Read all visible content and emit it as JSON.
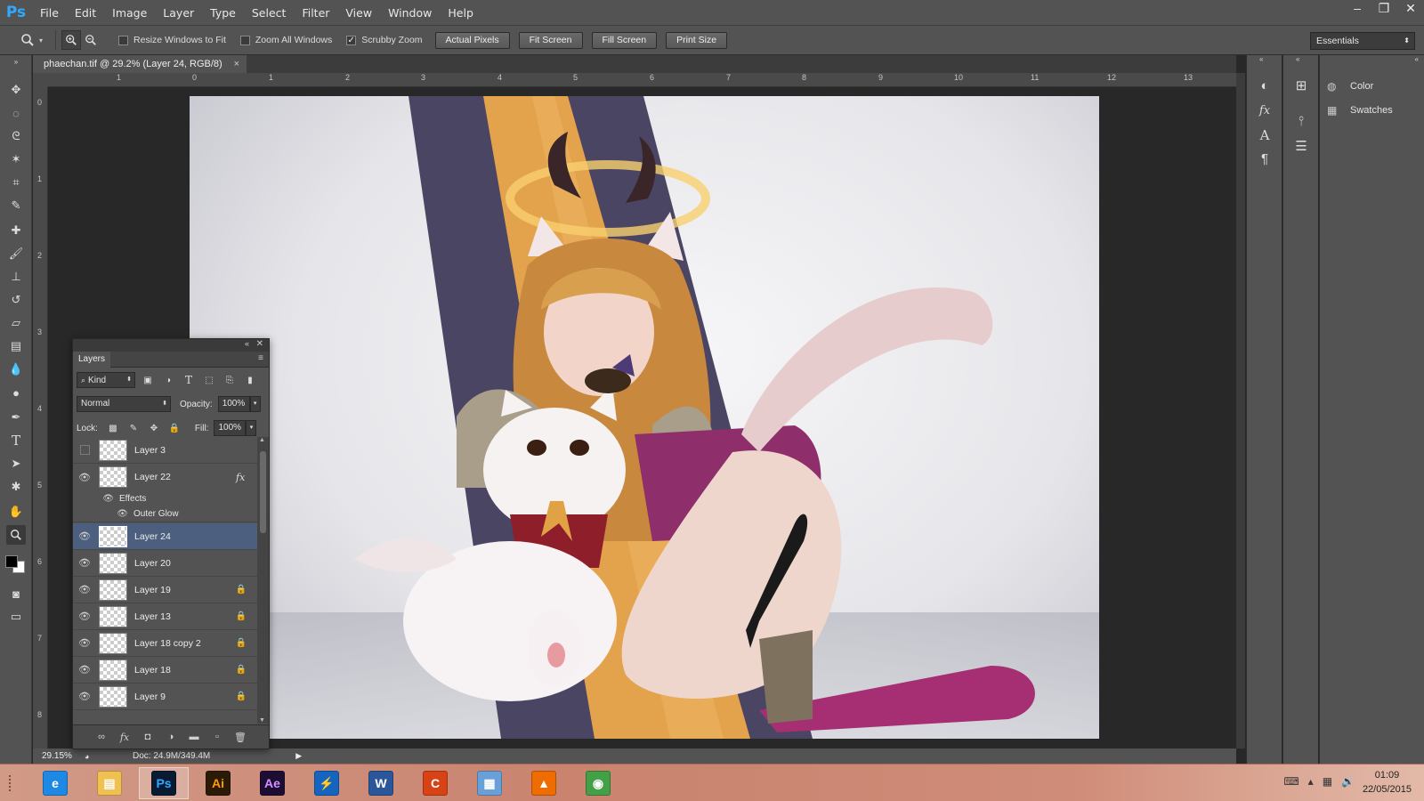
{
  "app": {
    "logo": "Ps"
  },
  "menu": [
    "File",
    "Edit",
    "Image",
    "Layer",
    "Type",
    "Select",
    "Filter",
    "View",
    "Window",
    "Help"
  ],
  "window_controls": [
    "–",
    "❐",
    "✕"
  ],
  "options": {
    "checks": [
      {
        "label": "Resize Windows to Fit",
        "checked": false
      },
      {
        "label": "Zoom All Windows",
        "checked": false
      },
      {
        "label": "Scrubby Zoom",
        "checked": true
      }
    ],
    "buttons": [
      "Actual Pixels",
      "Fit Screen",
      "Fill Screen",
      "Print Size"
    ],
    "workspace": "Essentials"
  },
  "document": {
    "tab_title": "phaechan.tif @ 29.2% (Layer 24, RGB/8)",
    "close": "×"
  },
  "rulers": {
    "top": [
      "1",
      "0",
      "1",
      "2",
      "3",
      "4",
      "5",
      "6",
      "7",
      "8",
      "9",
      "10",
      "11",
      "12",
      "13"
    ],
    "left": [
      "0",
      "1",
      "2",
      "3",
      "4",
      "5",
      "6",
      "7",
      "8"
    ]
  },
  "status": {
    "zoom": "29.15%",
    "doc": "Doc: 24.9M/349.4M"
  },
  "right_panel": {
    "items": [
      "Color",
      "Swatches"
    ]
  },
  "layers_panel": {
    "title": "Layers",
    "kind_label": "Kind",
    "blend_mode": "Normal",
    "opacity_label": "Opacity:",
    "opacity_value": "100%",
    "lock_label": "Lock:",
    "fill_label": "Fill:",
    "fill_value": "100%",
    "layers": [
      {
        "name": "Layer 3",
        "visible": false,
        "locked": false,
        "fx": false
      },
      {
        "name": "Layer 22",
        "visible": true,
        "locked": false,
        "fx": true
      },
      {
        "name": "Layer 24",
        "visible": true,
        "locked": false,
        "fx": false,
        "selected": true
      },
      {
        "name": "Layer 20",
        "visible": true,
        "locked": false,
        "fx": false
      },
      {
        "name": "Layer 19",
        "visible": true,
        "locked": true,
        "fx": false
      },
      {
        "name": "Layer 13",
        "visible": true,
        "locked": true,
        "fx": false
      },
      {
        "name": "Layer 18 copy 2",
        "visible": true,
        "locked": true,
        "fx": false
      },
      {
        "name": "Layer 18",
        "visible": true,
        "locked": true,
        "fx": false
      },
      {
        "name": "Layer 9",
        "visible": true,
        "locked": true,
        "fx": false
      }
    ],
    "effects_label": "Effects",
    "effect_name": "Outer Glow",
    "fx_symbol": "fx"
  },
  "taskbar": {
    "apps": [
      {
        "name": "Internet Explorer",
        "label": "e",
        "color": "#1e88e5"
      },
      {
        "name": "File Explorer",
        "label": "▤",
        "color": "#f0c050"
      },
      {
        "name": "Photoshop",
        "label": "Ps",
        "color": "#0b1a33",
        "active": true
      },
      {
        "name": "Illustrator",
        "label": "Ai",
        "color": "#2b1a05"
      },
      {
        "name": "After Effects",
        "label": "Ae",
        "color": "#1d0d33"
      },
      {
        "name": "Lightning",
        "label": "⚡",
        "color": "#1565c0"
      },
      {
        "name": "Word",
        "label": "W",
        "color": "#2b579a"
      },
      {
        "name": "CCleaner",
        "label": "C",
        "color": "#d84315"
      },
      {
        "name": "Calculator",
        "label": "▦",
        "color": "#6aa0d8"
      },
      {
        "name": "VLC",
        "label": "▲",
        "color": "#ef6c00"
      },
      {
        "name": "Chrome",
        "label": "◉",
        "color": "#43a047"
      }
    ],
    "time": "01:09",
    "date": "22/05/2015"
  },
  "colors": {
    "chrome": "#535353",
    "canvas_bg": "#282828",
    "selected_layer": "#4c5f7e"
  }
}
